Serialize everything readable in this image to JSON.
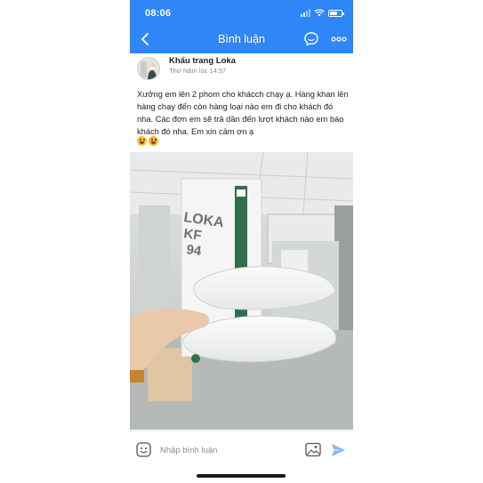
{
  "status_bar": {
    "time": "08:06",
    "icons": [
      "signal-icon",
      "wifi-icon",
      "battery-icon"
    ]
  },
  "nav": {
    "title": "Bình luận",
    "icons": [
      "back-chevron-icon",
      "comment-bubble-icon",
      "more-dots-icon"
    ]
  },
  "post": {
    "author": "Khẩu trang Loka",
    "time": "Thứ Năm lúc 14:57",
    "text": "Xưởng em lên 2 phom cho khácch chạy ạ. Hàng khan lên hàng chạy đến còn hàng loại nào em đi cho khách đó nha. Các đơn em sẽ trả dần đến lượt khách nào em báo khách đó nha. Em xin cảm ơn ạ",
    "emojis": [
      "grinning-tongue-emoji",
      "kissing-wink-emoji"
    ],
    "photo": {
      "description_icon": "photo-image",
      "package_text": [
        "LOKA",
        "KF",
        "94"
      ]
    }
  },
  "composer": {
    "placeholder": "Nhập bình luận",
    "icons": [
      "emoji-icon",
      "image-icon",
      "send-icon"
    ]
  },
  "colors": {
    "brand_blue": "#2f86f6",
    "send_blue": "#8cb8ef",
    "text": "#222222",
    "muted": "#8a8a8a"
  }
}
